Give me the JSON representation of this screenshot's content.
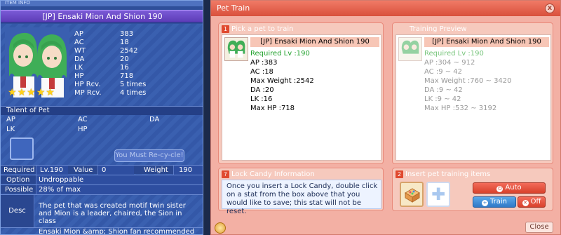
{
  "item_info": {
    "window_title": "ITEM INFO",
    "name": "[JP] Ensaki Mion And Shion 190",
    "stats": [
      {
        "key": "AP",
        "value": "383"
      },
      {
        "key": "AC",
        "value": "18"
      },
      {
        "key": "WT",
        "value": "2542"
      },
      {
        "key": "DA",
        "value": "20"
      },
      {
        "key": "LK",
        "value": "16"
      },
      {
        "key": "HP",
        "value": "718"
      },
      {
        "key": "HP Rcv.",
        "value": "5 times"
      },
      {
        "key": "MP Rcv.",
        "value": "4 times"
      }
    ],
    "stars": 5,
    "talent_title": "Talent of Pet",
    "talent": {
      "ap": "AP",
      "ac": "AC",
      "da": "DA",
      "lk": "LK",
      "hp": "HP"
    },
    "recycle_label": "You Must Re-cy-cle!",
    "required_label": "Required",
    "required_value": "Lv.190",
    "value_label": "Value",
    "value_value": "0",
    "weight_label": "Weight",
    "weight_value": "190",
    "option_label": "Option",
    "option_value": "Undroppable",
    "possible_label": "Possible",
    "possible_value": "28% of max",
    "desc_label": "Desc",
    "desc_text": "The pet that was created motif twin sister and Mion is a leader, chaired, the Sion in class",
    "fan_text": "Ensaki Mion &amp; Shion fan recommended"
  },
  "pet_train": {
    "title": "Pet Train",
    "close_x": "x",
    "pick": {
      "num": "1",
      "heading": "Pick a pet to train",
      "pet_name": "[JP] Ensaki Mion And Shion 190",
      "required": "Required Lv :190",
      "lines": [
        "AP :383",
        "AC :18",
        "Max Weight :2542",
        "DA :20",
        "LK :16",
        "Max HP :718"
      ]
    },
    "preview": {
      "heading": "Training Preview",
      "pet_name": "[JP] Ensaki Mion And Shion 190",
      "required": "Required Lv :190",
      "lines": [
        "AP :304 ~ 912",
        "AC :9 ~ 42",
        "Max Weight :760 ~ 3420",
        "DA :9 ~ 42",
        "LK :9 ~ 42",
        "Max HP :532 ~ 3192"
      ]
    },
    "lock": {
      "num": "?",
      "heading": "Lock Candy Information",
      "text": "Once you insert a Lock Candy, double click on a stat from the box above that you would like to save; this stat will not be reset."
    },
    "items": {
      "num": "2",
      "heading": "Insert pet training items",
      "auto_label": "Auto",
      "train_label": "Train",
      "off_label": "Off"
    },
    "close_label": "Close"
  }
}
